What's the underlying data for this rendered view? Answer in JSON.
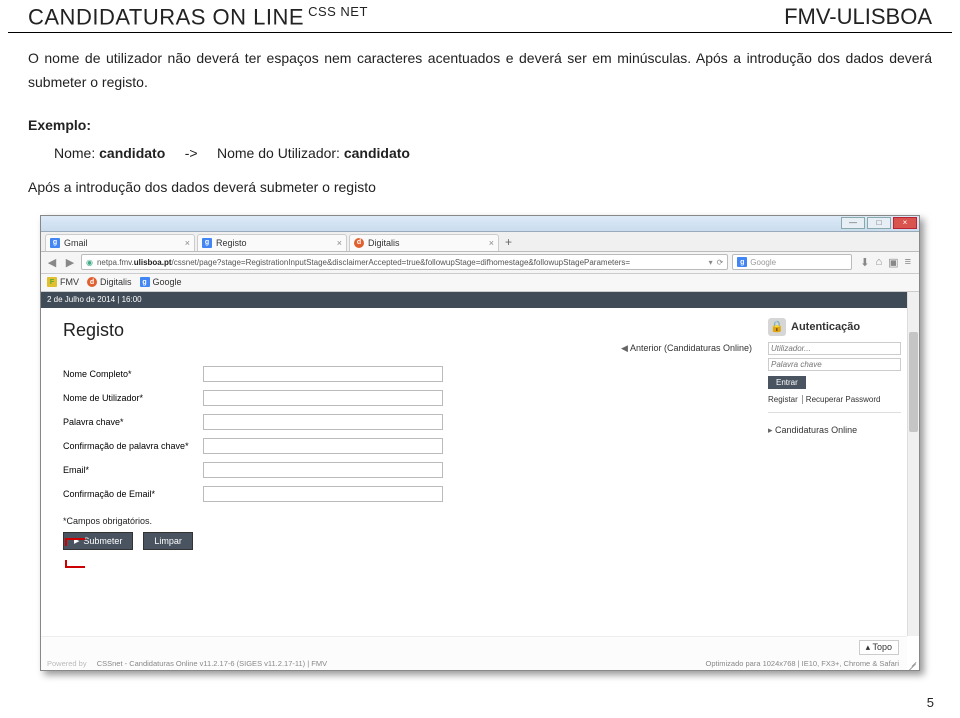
{
  "header": {
    "left_main": "CANDIDATURAS ON LINE",
    "left_sup": "CSS NET",
    "right": "FMV-ULISBOA"
  },
  "paragraph": "O nome de utilizador não deverá ter espaços nem caracteres acentuados e deverá ser em minúsculas. Após a introdução dos dados deverá submeter o registo.",
  "example": {
    "title": "Exemplo:",
    "line_left": "Nome:",
    "name_value": "candidato",
    "sep": "->",
    "line_right": "Nome do Utilizador:",
    "user_value": "candidato"
  },
  "after_paragraph": "Após a introdução dos dados deverá submeter o registo",
  "browser": {
    "win_min": "—",
    "win_max": "□",
    "win_close": "×",
    "tabs": [
      {
        "icon": "g",
        "label": "Gmail"
      },
      {
        "icon": "g",
        "label": "Registo"
      },
      {
        "icon": "d",
        "label": "Digitalis"
      }
    ],
    "tab_add": "+",
    "url_prefix": "netpa.fmv.",
    "url_host": "ulisboa.pt",
    "url_path": "/cssnet/page?stage=RegistrationInputStage&disclaimerAccepted=true&followupStage=difhomestage&followupStageParameters=",
    "reload": "⟳",
    "search_placeholder": "Google",
    "bookmarks": [
      {
        "icon": "f",
        "label": "FMV"
      },
      {
        "icon": "d",
        "label": "Digitalis"
      },
      {
        "icon": "g",
        "label": "Google"
      }
    ],
    "date": "2 de Julho de 2014 | 16:00"
  },
  "form": {
    "heading": "Registo",
    "prev": "Anterior (Candidaturas Online)",
    "fields": {
      "nome_completo": "Nome Completo*",
      "nome_utilizador": "Nome de Utilizador*",
      "palavra_chave": "Palavra chave*",
      "conf_palavra_chave": "Confirmação de palavra chave*",
      "email": "Email*",
      "conf_email": "Confirmação de Email*"
    },
    "mandatory": "*Campos obrigatórios.",
    "submit": "Submeter",
    "clear": "Limpar"
  },
  "sidebar": {
    "auth_title": "Autenticação",
    "user_ph": "Utilizador...",
    "pass_ph": "Palavra chave",
    "enter": "Entrar",
    "link_register": "Registar",
    "link_recover": "Recuperar Password",
    "cand_online": "Candidaturas Online"
  },
  "footer": {
    "topo": "Topo",
    "powered": "Powered by",
    "version": "CSSnet - Candidaturas Online v11.2.17-6 (SIGES v11.2.17-11) | FMV",
    "optimized": "Optimizado para 1024x768 | IE10, FX3+, Chrome & Safari"
  },
  "pagenum": "5"
}
